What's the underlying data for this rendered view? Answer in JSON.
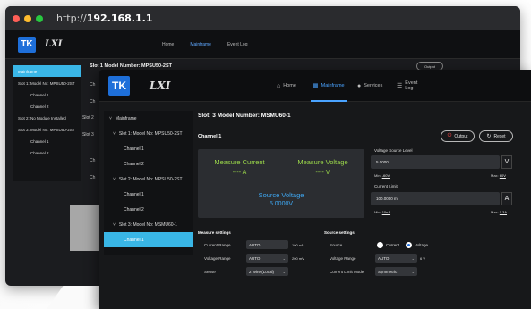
{
  "back_window": {
    "url_prefix": "http://",
    "url_host": "192.168.1.1",
    "logo": "TK",
    "brand": "LXI",
    "nav": [
      "Home",
      "Mainframe",
      "Event Log"
    ],
    "sidebar": [
      "Mainframe",
      "Slot 1: Model No: MPSU50-2ST",
      "Channel 1",
      "Channel 2",
      "Slot 2: No Module Installed",
      "Slot 3: Model No: MPSU50-2ST",
      "Channel 1",
      "Channel 2"
    ],
    "slot_title": "Slot 1  Model Number: MPSU50-2ST",
    "output_label": "Output",
    "fragments": [
      "Ch",
      "Ch",
      "Slot 2",
      "Slot 3",
      "Ch",
      "Ch"
    ]
  },
  "header": {
    "logo": "TK",
    "brand": "LXI",
    "nav": [
      {
        "label": "Home",
        "icon": "home-icon",
        "glyph": "⌂"
      },
      {
        "label": "Mainframe",
        "icon": "mainframe-icon",
        "glyph": "▦"
      },
      {
        "label": "Services",
        "icon": "services-icon",
        "glyph": "●"
      },
      {
        "label": "Event Log",
        "icon": "event-log-icon",
        "glyph": "☰"
      }
    ],
    "active_nav": "Mainframe"
  },
  "sidebar": {
    "items": [
      {
        "label": "Mainframe"
      },
      {
        "label": "Slot 1: Model No: MPSU50-2ST"
      },
      {
        "label": "Channel 1"
      },
      {
        "label": "Channel 2"
      },
      {
        "label": "Slot 2: Model No: MPSU50-2ST"
      },
      {
        "label": "Channel 1"
      },
      {
        "label": "Channel 2"
      },
      {
        "label": "Slot 3: Model No: MSMU60-1"
      },
      {
        "label": "Channel 1"
      }
    ],
    "selected_index": 8
  },
  "main": {
    "slot_title": "Slot: 3  Model Number: MSMU60-1",
    "channel_title": "Channel 1",
    "output_button": "Output",
    "reset_button": "Reset",
    "measure": {
      "current_label": "Measure Current",
      "current_value": "---- A",
      "voltage_label": "Measure Voltage",
      "voltage_value": "---- V",
      "source_label": "Source Voltage",
      "source_value": "5.0000V",
      "green_color": "#9bd84a",
      "blue_color": "#3fa9f5"
    },
    "voltage_source": {
      "label": "Voltage Source Level",
      "value": "5.0000",
      "unit": "V",
      "min_prefix": "Min:",
      "min_value": "-60V",
      "max_prefix": "Max:",
      "max_value": "60V"
    },
    "current_limit": {
      "label": "Current Limit",
      "value": "100.0000 m",
      "unit": "A",
      "min_prefix": "Min:",
      "min_value": "10nA",
      "max_prefix": "Max:",
      "max_value": "1.3A"
    },
    "measure_settings": {
      "title": "Measure settings",
      "rows": [
        {
          "label": "Current Range",
          "value": "AUTO",
          "unit": "100 nA"
        },
        {
          "label": "Voltage Range",
          "value": "AUTO",
          "unit": "200 mV"
        },
        {
          "label": "Sense",
          "value": "2 Wire (Local)",
          "unit": ""
        }
      ]
    },
    "source_settings": {
      "title": "Source settings",
      "source_label": "Source",
      "option_current": "Current",
      "option_voltage": "Voltage",
      "selected_option": "Voltage",
      "voltage_range_label": "Voltage Range",
      "voltage_range_value": "AUTO",
      "voltage_range_unit": "6 V",
      "current_limit_mode_label": "Current Limit Mode",
      "current_limit_mode_value": "Symmetric"
    }
  }
}
